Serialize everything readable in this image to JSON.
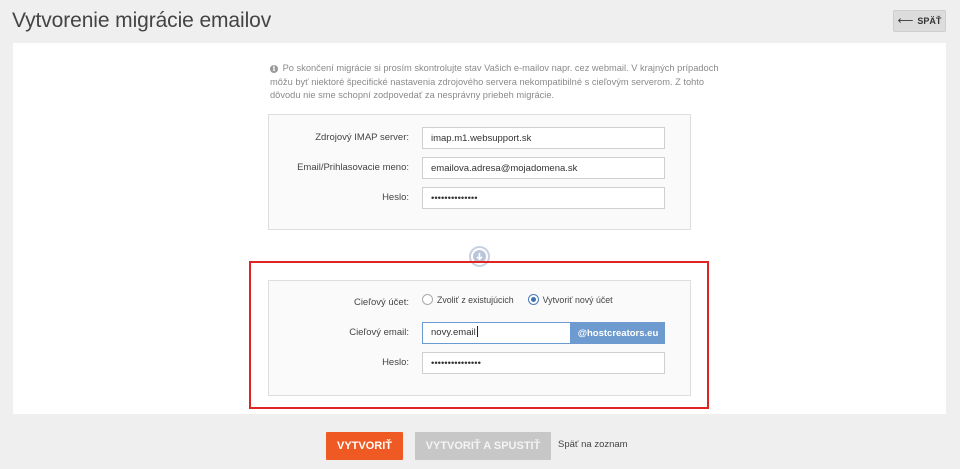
{
  "header": {
    "title": "Vytvorenie migrácie emailov",
    "back_label": "SPÄŤ",
    "back_icon": "arrow-left-icon"
  },
  "info": {
    "icon": "info-icon",
    "text": "Po skončení migrácie si prosím skontrolujte stav Vašich e-mailov napr. cez webmail. V krajných prípadoch môžu byť niektoré špecifické nastavenia zdrojového servera nekompatibilné s cieľovým serverom. Z tohto dôvodu nie sme schopní zodpovedať za nesprávny priebeh migrácie."
  },
  "source": {
    "imap_label": "Zdrojový IMAP server:",
    "imap_value": "imap.m1.websupport.sk",
    "login_label": "Email/Prihlasovacie meno:",
    "login_value": "emailova.adresa@mojadomena.sk",
    "password_label": "Heslo:",
    "password_value": "••••••••••••••"
  },
  "arrow_icon": "arrow-down-circle-icon",
  "target": {
    "account_label": "Cieľový účet:",
    "options": [
      {
        "label": "Zvoliť z existujúcich",
        "selected": false
      },
      {
        "label": "Vytvoriť nový účet",
        "selected": true
      }
    ],
    "email_label": "Cieľový email:",
    "email_value": "novy.email",
    "email_domain": "@hostcreators.eu",
    "password_label": "Heslo:",
    "password_value": "•••••••••••••••"
  },
  "actions": {
    "create_label": "VYTVORIŤ",
    "create_run_label": "VYTVORIŤ A SPUSTIŤ",
    "back_prefix": "Späť",
    "back_suffix": " na zoznam"
  },
  "colors": {
    "primary": "#ef5a24",
    "disabled": "#c7c7c7",
    "domain_addon": "#6e9bcf",
    "highlight": "#e02424"
  }
}
